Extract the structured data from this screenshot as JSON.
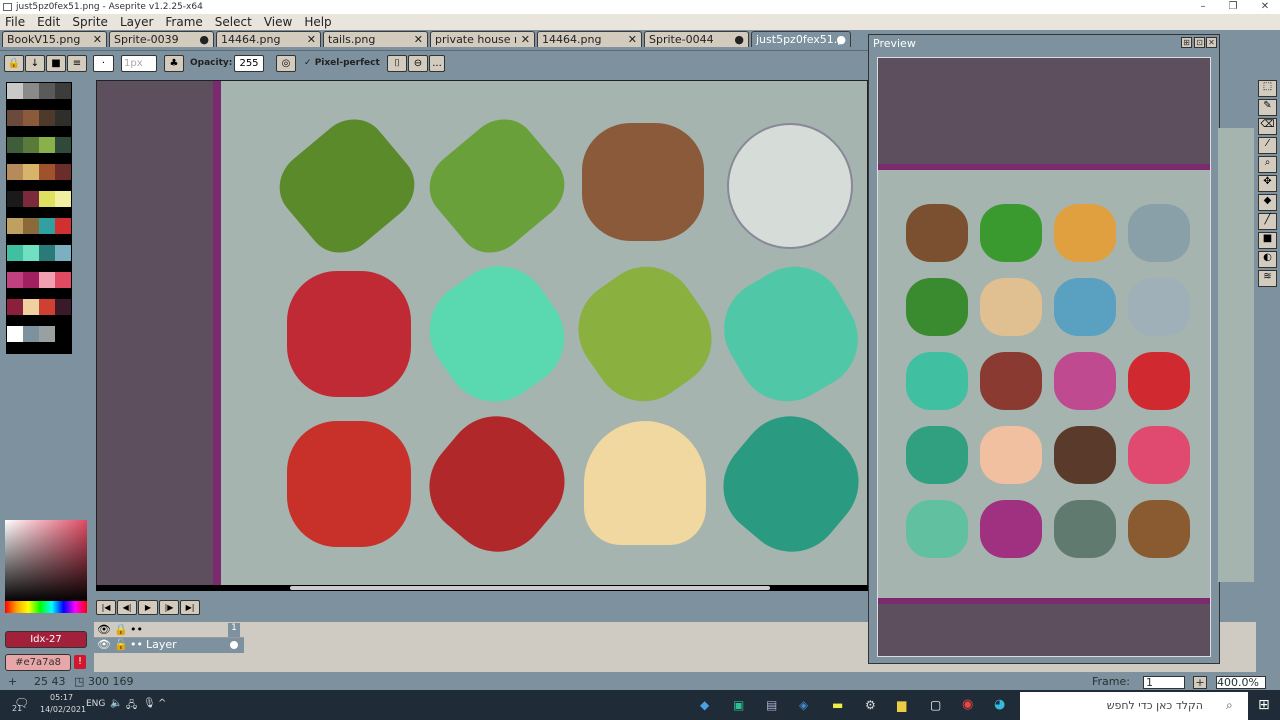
{
  "window": {
    "title": "just5pz0fex51.png - Aseprite v1.2.25-x64",
    "minimize": "–",
    "maximize": "❐",
    "close": "✕"
  },
  "menu": [
    "File",
    "Edit",
    "Sprite",
    "Layer",
    "Frame",
    "Select",
    "View",
    "Help"
  ],
  "tabs": [
    {
      "label": "BookV15.png",
      "mark": "✕"
    },
    {
      "label": "Sprite-0039",
      "mark": "●"
    },
    {
      "label": "14464.png",
      "mark": "✕"
    },
    {
      "label": "tails.png",
      "mark": "✕"
    },
    {
      "label": "private house ı",
      "mark": "✕"
    },
    {
      "label": "14464.png",
      "mark": "✕"
    },
    {
      "label": "Sprite-0044",
      "mark": "●"
    },
    {
      "label": "just5pz0fex51.p",
      "mark": "●"
    }
  ],
  "toolbar": {
    "brush_size": "1px",
    "opacity_label": "Opacity:",
    "opacity": "255",
    "pixel_perfect": "Pixel-perfect",
    "pixel_perfect_checked": true,
    "more": "..."
  },
  "palette": {
    "colors": [
      "#c9c9c9",
      "#8a8a8a",
      "#5a5a5a",
      "#3c3c3c",
      "#6b4a3c",
      "#8a5a3b",
      "#4d3a2a",
      "#2e2f2a",
      "#3e5e3a",
      "#5a7a3a",
      "#8ab04a",
      "#2d4a3a",
      "#b78a5c",
      "#d8b36a",
      "#a0522d",
      "#6b2d2a",
      "#1a1a1a",
      "#7a2a3a",
      "#e0e060",
      "#f0f0a0",
      "#c0a060",
      "#8a6a3a",
      "#30a0a0",
      "#d03030",
      "#40c0a0",
      "#70e0c0",
      "#2a7a7a",
      "#7ab0c0",
      "#c04080",
      "#a02060",
      "#f0a0b0",
      "#e04a63",
      "#8a203b",
      "#f0d0a0",
      "#d04030",
      "#3a1a2a",
      "#ffffff",
      "#7d929e",
      "#9aa0a0",
      "#000000"
    ]
  },
  "color": {
    "index": "Idx-27",
    "hex": "#e7a7a8",
    "warning": "!"
  },
  "timeline": {
    "frame_number": "1",
    "layer_name": "Layer",
    "buttons": [
      "|◀",
      "◀|",
      "▶",
      "|▶",
      "▶|"
    ]
  },
  "status": {
    "position": "25 43",
    "size": "300 169",
    "frame_label": "Frame:",
    "frame": "1",
    "zoom": "400.0%",
    "plus": "+"
  },
  "preview": {
    "title": "Preview"
  },
  "taskbar": {
    "time": "05:17",
    "date": "14/02/2021",
    "lang": "ENG",
    "notifications": "21",
    "search_placeholder": "הקלד כאן כדי לחפש"
  }
}
